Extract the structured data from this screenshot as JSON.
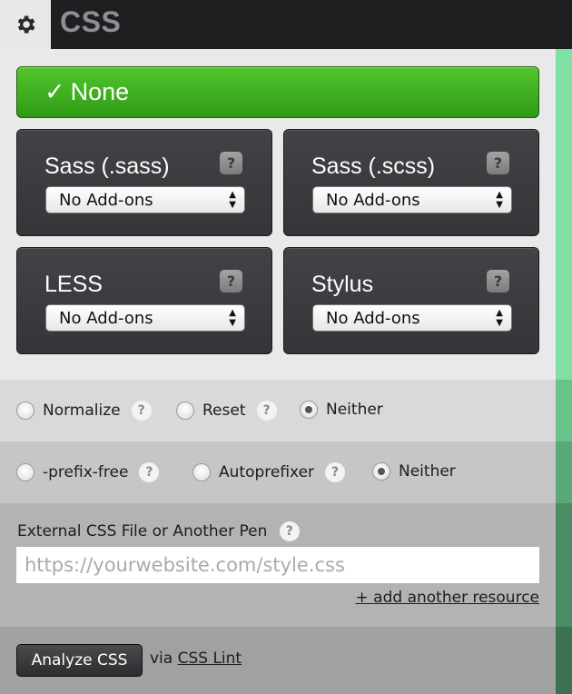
{
  "header": {
    "title": "CSS",
    "settings_icon": "gear-icon"
  },
  "preprocessor": {
    "none_button": {
      "check": "✓",
      "label": "None"
    },
    "cards": [
      {
        "name": "Sass (.sass)",
        "help": "?",
        "select": "No Add-ons"
      },
      {
        "name": "Sass (.scss)",
        "help": "?",
        "select": "No Add-ons"
      },
      {
        "name": "LESS",
        "help": "?",
        "select": "No Add-ons"
      },
      {
        "name": "Stylus",
        "help": "?",
        "select": "No Add-ons"
      }
    ]
  },
  "base_options": {
    "items": [
      {
        "label": "Normalize",
        "help": "?",
        "checked": false
      },
      {
        "label": "Reset",
        "help": "?",
        "checked": false
      },
      {
        "label": "Neither",
        "checked": true
      }
    ]
  },
  "prefix_options": {
    "items": [
      {
        "label": "-prefix-free",
        "help": "?",
        "checked": false
      },
      {
        "label": "Autoprefixer",
        "help": "?",
        "checked": false
      },
      {
        "label": "Neither",
        "checked": true
      }
    ]
  },
  "external": {
    "label": "External CSS File or Another Pen",
    "help": "?",
    "placeholder": "https://yourwebsite.com/style.css",
    "add_link": "+ add another resource"
  },
  "analyze": {
    "button": "Analyze CSS",
    "via": "via",
    "link": "CSS Lint"
  },
  "colors": {
    "accent_green": "#3bb01f",
    "stripe_green": "#7fdc9f"
  }
}
